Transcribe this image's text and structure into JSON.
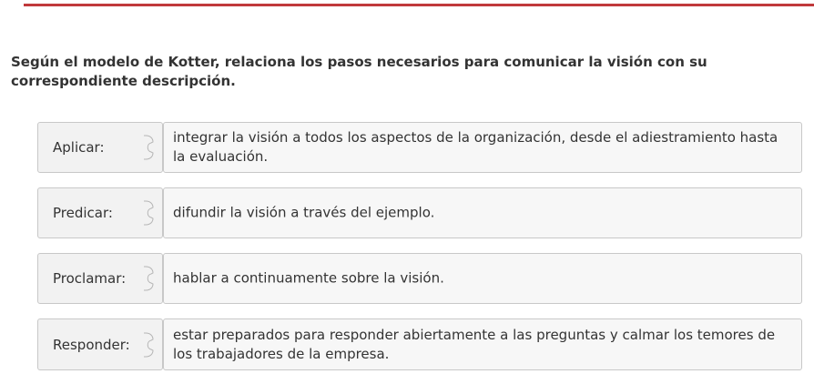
{
  "question": "Según el modelo de Kotter, relaciona los pasos necesarios para comunicar la visión con su correspondiente descripción.",
  "pairs": [
    {
      "term": "Aplicar:",
      "description": "integrar la visión a todos los aspectos de la organización, desde el adiestramiento hasta la evaluación."
    },
    {
      "term": "Predicar:",
      "description": "difundir la visión a través del ejemplo."
    },
    {
      "term": "Proclamar:",
      "description": "hablar a continuamente sobre la visión."
    },
    {
      "term": "Responder:",
      "description": "estar preparados para responder abiertamente a las preguntas y calmar los temores de los trabajadores de la empresa."
    }
  ],
  "colors": {
    "accent": "#c0393b",
    "tile_background": "#f2f2f2",
    "tile_border": "#c8c8c8"
  },
  "icons": {
    "connector": "puzzle-tab-icon"
  }
}
